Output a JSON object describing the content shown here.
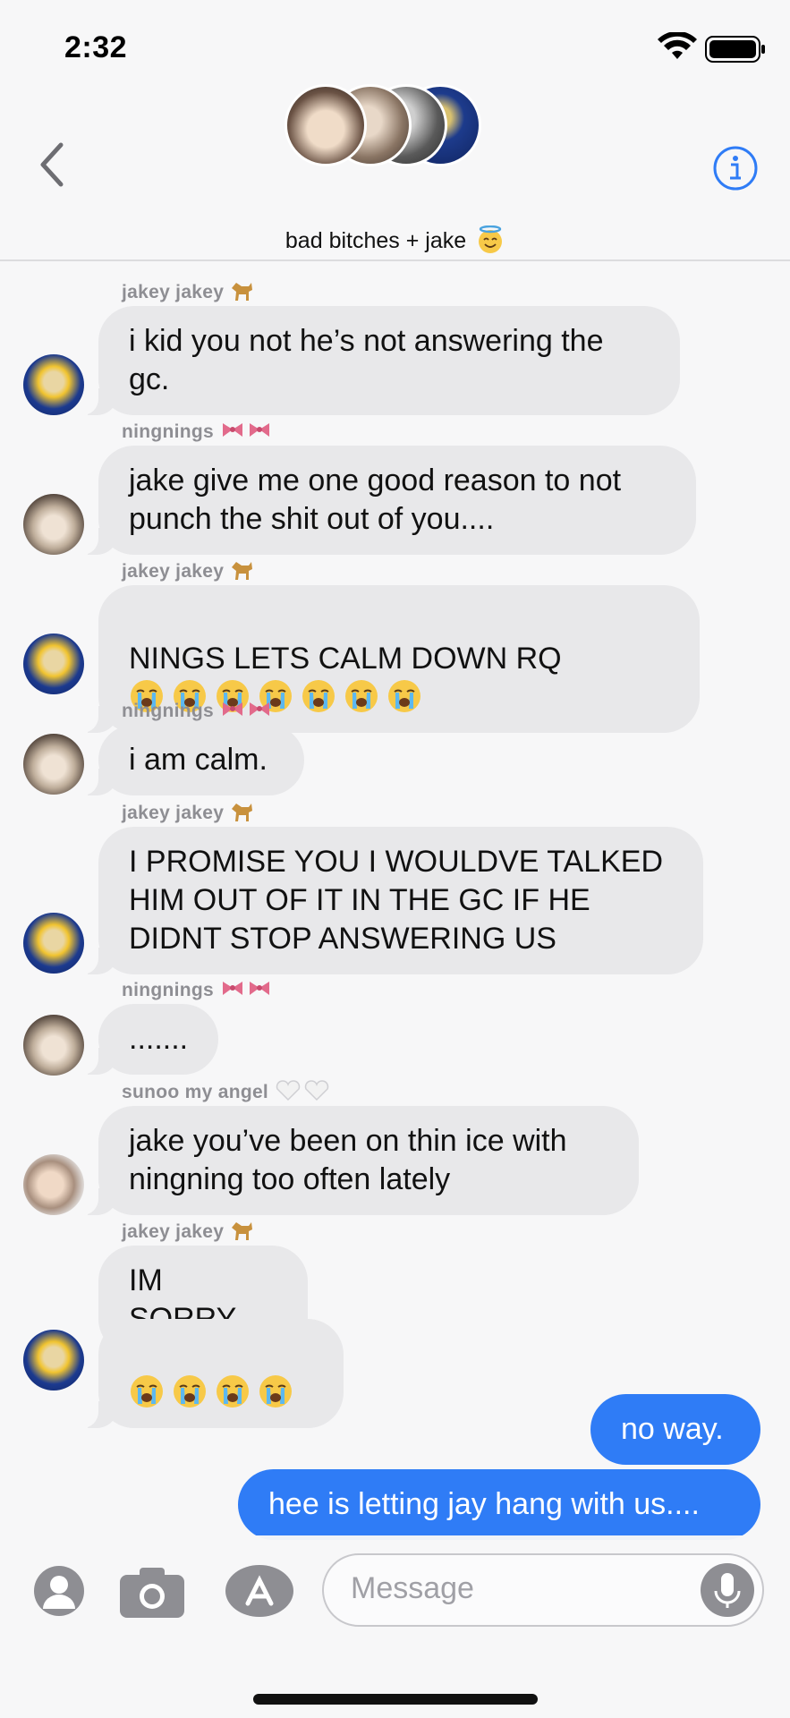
{
  "status_bar": {
    "time": "2:32",
    "wifi_icon": "wifi-icon",
    "battery_icon": "battery-full-icon"
  },
  "header": {
    "back_icon": "chevron-left-icon",
    "info_icon": "info-circle-icon",
    "group_title": "bad bitches + jake",
    "group_title_emoji": "smiling-face-with-halo",
    "avatar_count": 4
  },
  "messages": [
    {
      "sender": "jakey jakey",
      "sender_emoji": "dog",
      "text": "i kid you not he’s not answering the gc.",
      "emoji": []
    },
    {
      "sender": "ningnings",
      "sender_emoji": "ribbons",
      "text": "jake give me one good reason to not punch the shit out of you....",
      "emoji": []
    },
    {
      "sender": "jakey jakey",
      "sender_emoji": "dog",
      "text": "NINGS LETS CALM DOWN RQ",
      "emoji": [
        "loudly-crying-face",
        "loudly-crying-face",
        "loudly-crying-face",
        "loudly-crying-face",
        "loudly-crying-face",
        "loudly-crying-face",
        "loudly-crying-face"
      ]
    },
    {
      "sender": "ningnings",
      "sender_emoji": "ribbons",
      "text": "i am calm.",
      "emoji": []
    },
    {
      "sender": "jakey jakey",
      "sender_emoji": "dog",
      "text": "I PROMISE YOU I WOULDVE TALKED HIM OUT OF IT IN THE GC IF HE DIDNT STOP ANSWERING US",
      "emoji": []
    },
    {
      "sender": "ningnings",
      "sender_emoji": "ribbons",
      "text": ".......",
      "emoji": []
    },
    {
      "sender": "sunoo my angel",
      "sender_emoji": "white-hearts",
      "text": "jake you’ve been on thin ice with ningning too often lately",
      "emoji": []
    },
    {
      "sender": "jakey jakey",
      "sender_emoji": "dog",
      "text": "IM SORRY",
      "emoji": []
    },
    {
      "sender": "",
      "text": "",
      "emoji": [
        "loudly-crying-face",
        "loudly-crying-face",
        "loudly-crying-face",
        "loudly-crying-face"
      ]
    },
    {
      "direction": "outgoing",
      "text": "no way."
    },
    {
      "direction": "outgoing",
      "text": "hee is letting jay hang with us...."
    }
  ],
  "input_bar": {
    "placeholder": "Message",
    "icons": [
      "contact-icon",
      "camera-icon",
      "app-store-icon",
      "microphone-icon"
    ]
  },
  "colors": {
    "outgoing_bubble": "#2f7cf6",
    "incoming_bubble": "#e8e8ea",
    "accent": "#2f7cf6"
  }
}
